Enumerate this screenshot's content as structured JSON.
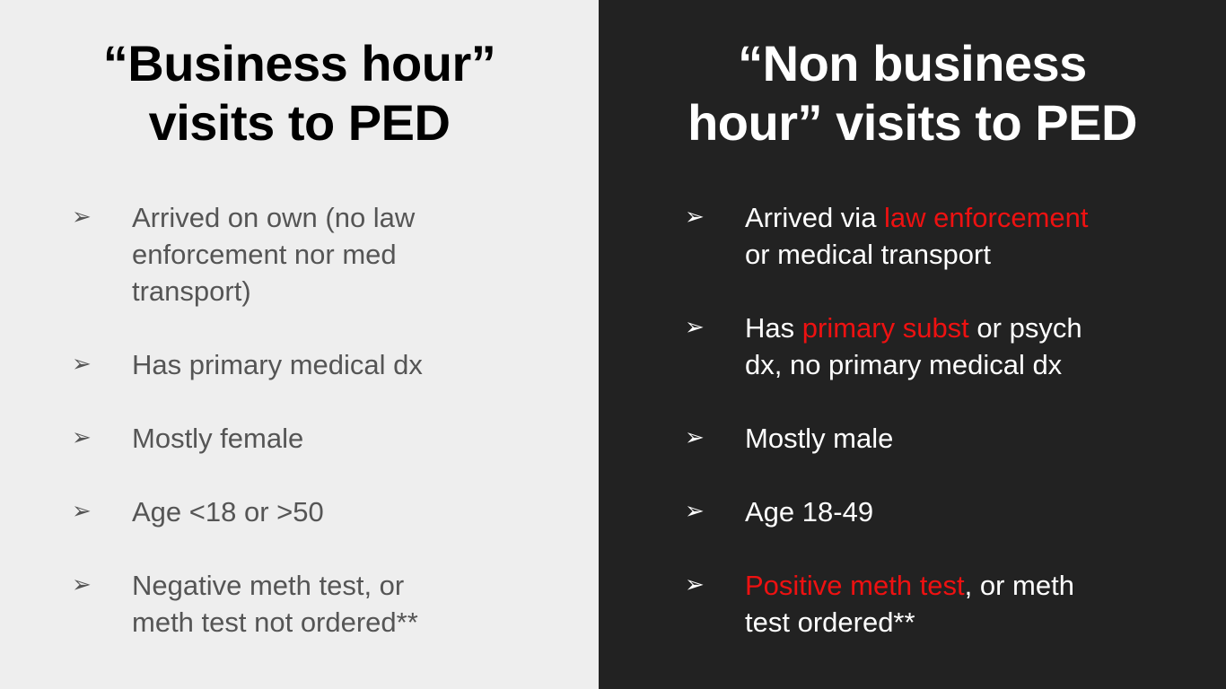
{
  "colors": {
    "left_background": "#eeeeee",
    "right_background": "#222222",
    "highlight": "#ee1111"
  },
  "bullet_glyph": "➢",
  "left": {
    "title_lines": [
      "“Business hour”",
      "visits to PED"
    ],
    "items": [
      {
        "lines": [
          "Arrived on own (no law",
          "enforcement nor med",
          "transport)"
        ]
      },
      {
        "lines": [
          "Has primary medical dx"
        ]
      },
      {
        "lines": [
          "Mostly female"
        ]
      },
      {
        "lines": [
          "Age <18 or >50"
        ]
      },
      {
        "lines": [
          "Negative meth test, or",
          "meth test not ordered**"
        ]
      }
    ]
  },
  "right": {
    "title_lines": [
      "“Non business",
      "hour” visits to PED"
    ],
    "items": [
      {
        "l1_pre": "Arrived via ",
        "l1_hl": "law enforcement",
        "l2": "or medical transport"
      },
      {
        "l1_pre": "Has ",
        "l1_hl": "primary subst",
        "l1_post": " or psych",
        "l2": "dx, no primary medical dx"
      },
      {
        "l1": "Mostly male"
      },
      {
        "l1": "Age 18-49"
      },
      {
        "l1_hl": "Positive meth test",
        "l1_post": ", or meth",
        "l2": "test ordered**"
      }
    ]
  }
}
